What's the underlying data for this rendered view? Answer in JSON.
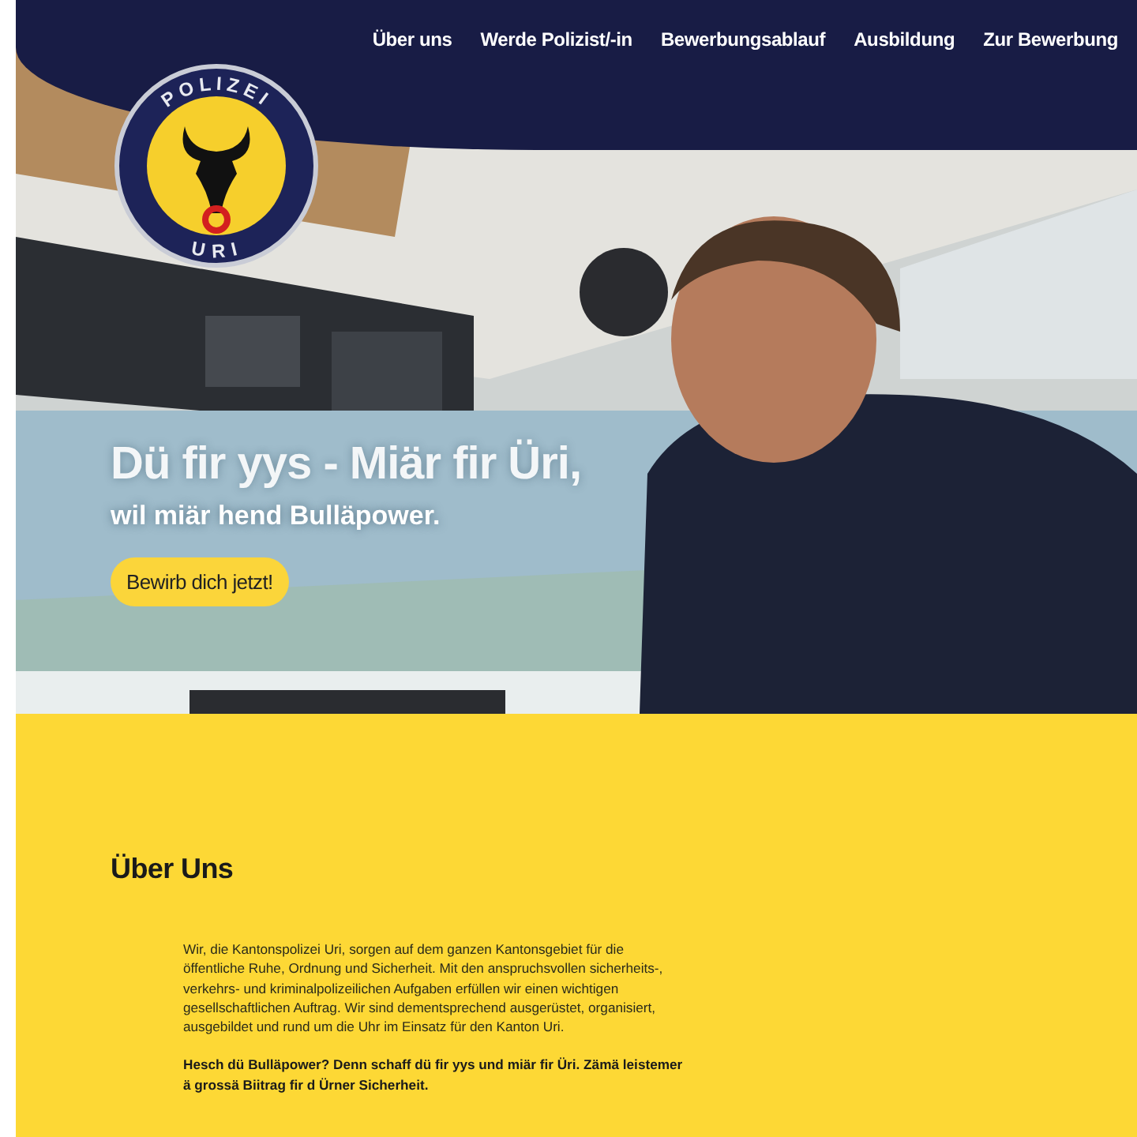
{
  "nav": {
    "items": [
      {
        "label": "Über uns"
      },
      {
        "label": "Werde Polizist/-in"
      },
      {
        "label": "Bewerbungsablauf"
      },
      {
        "label": "Ausbildung"
      },
      {
        "label": "Zur Bewerbung"
      }
    ]
  },
  "logo": {
    "top_text": "POLIZEI",
    "bottom_text": "URI"
  },
  "hero": {
    "title": "Dü fir yys - Miär fir Üri,",
    "subtitle": "wil miär hend Bulläpower.",
    "button": "Bewirb dich jetzt!"
  },
  "about": {
    "heading": "Über Uns",
    "paragraphs": [
      {
        "text": "Wir, die Kantonspolizei Uri, sorgen auf dem ganzen Kantonsgebiet für die öffentliche Ruhe, Ordnung und Sicherheit. Mit den anspruchsvollen sicherheits-, verkehrs- und kriminalpolizeilichen Aufgaben erfüllen wir einen wichtigen gesellschaftlichen Auftrag. Wir sind dementsprechend ausgerüstet, organisiert, ausgebildet und rund um die Uhr im Einsatz für den Kanton Uri.",
        "bold": false
      },
      {
        "text": "Hesch dü Bulläpower? Denn schaff dü fir yys und miär fir Üri. Zämä leistemer ä grossä Biitrag fir d Ürner Sicherheit.",
        "bold": true
      }
    ]
  }
}
